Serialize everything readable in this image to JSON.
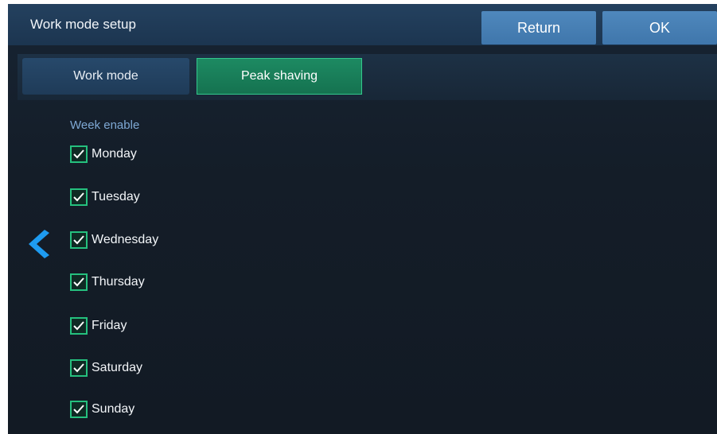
{
  "header": {
    "title": "Work mode setup",
    "return_label": "Return",
    "ok_label": "OK"
  },
  "tabs": [
    {
      "label": "Work mode",
      "active": false
    },
    {
      "label": "Peak shaving",
      "active": true
    }
  ],
  "week_enable": {
    "label": "Week enable",
    "days": [
      {
        "label": "Monday",
        "checked": true
      },
      {
        "label": "Tuesday",
        "checked": true
      },
      {
        "label": "Wednesday",
        "checked": true
      },
      {
        "label": "Thursday",
        "checked": true
      },
      {
        "label": "Friday",
        "checked": true
      },
      {
        "label": "Saturday",
        "checked": true
      },
      {
        "label": "Sunday",
        "checked": true
      }
    ]
  },
  "icons": {
    "back": "chevron-left-icon",
    "check": "checkmark-icon"
  },
  "colors": {
    "accent_green": "#25c07e",
    "header_button": "#4a82b8",
    "background": "#141d28"
  }
}
